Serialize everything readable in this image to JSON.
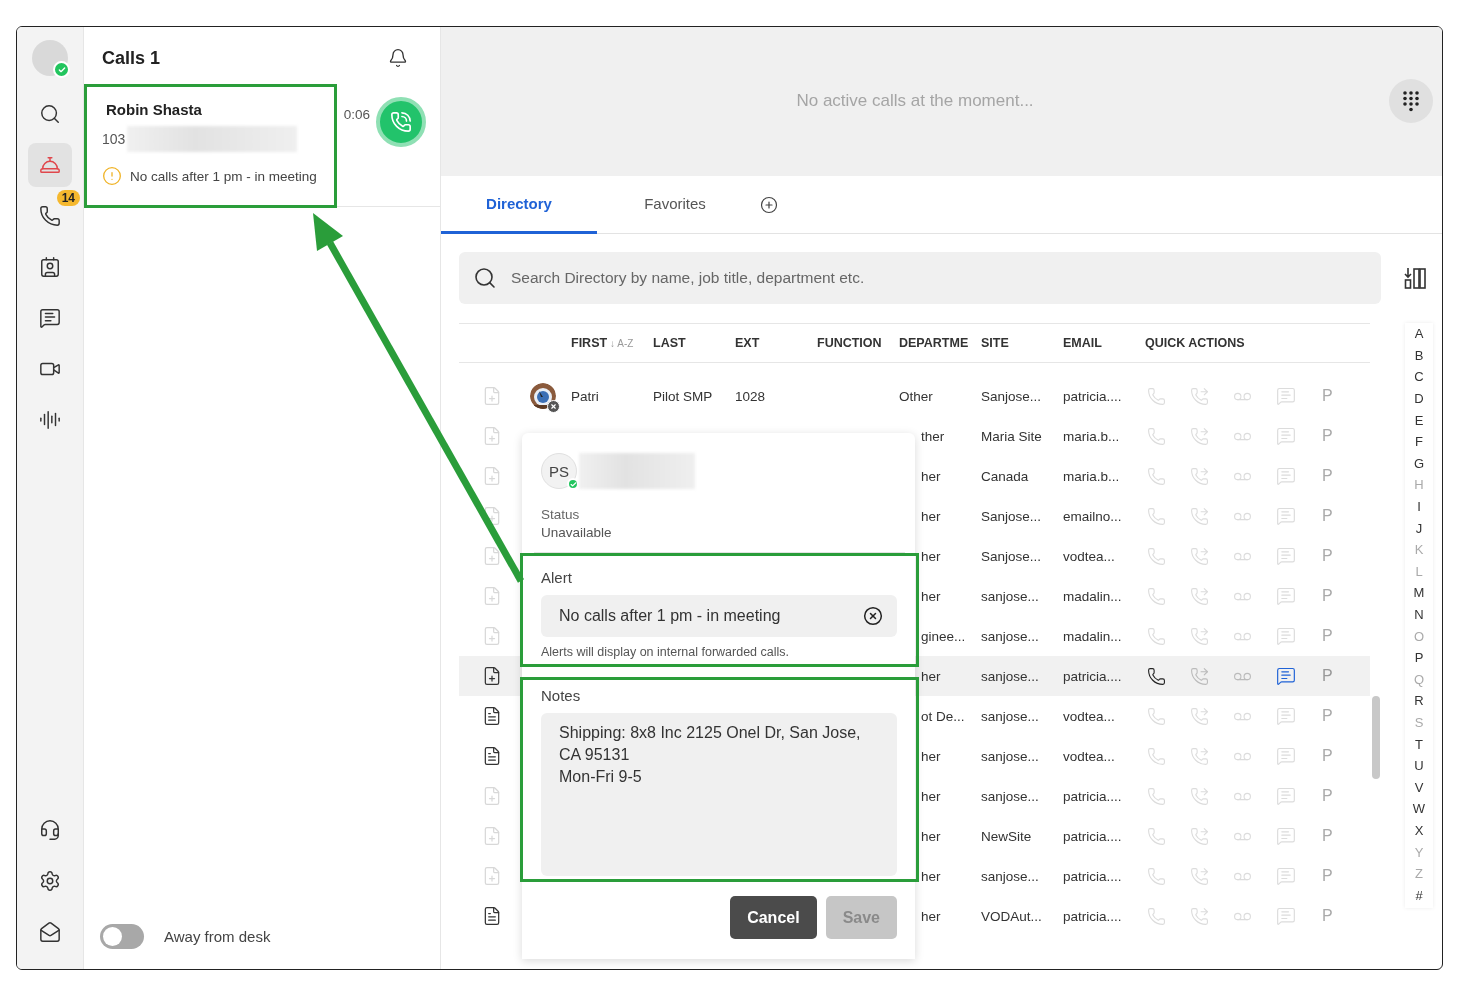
{
  "rail": {
    "user": {
      "online": true
    },
    "items": [
      {
        "kind": "search",
        "selected": false
      },
      {
        "kind": "reception",
        "selected": true
      },
      {
        "kind": "calls",
        "selected": false,
        "badge": "14"
      },
      {
        "kind": "contacts",
        "selected": false
      },
      {
        "kind": "chat",
        "selected": false
      },
      {
        "kind": "video",
        "selected": false
      },
      {
        "kind": "voice",
        "selected": false
      }
    ],
    "bottom_items": [
      {
        "kind": "support",
        "selected": false
      },
      {
        "kind": "settings",
        "selected": false
      },
      {
        "kind": "outbox",
        "selected": false
      }
    ]
  },
  "calls_panel": {
    "title": "Calls 1",
    "calls": [
      {
        "name": "Robin Shasta",
        "ext": "103",
        "alert": "No calls after 1 pm - in meeting",
        "timer": "0:06"
      }
    ],
    "away": {
      "label": "Away from desk",
      "on": false
    }
  },
  "main": {
    "empty_message": "No active calls at the moment...",
    "tabs": [
      {
        "label": "Directory",
        "selected": true
      },
      {
        "label": "Favorites",
        "selected": false
      }
    ],
    "search": {
      "placeholder": "Search Directory by name, job title, department etc."
    },
    "table": {
      "columns": [
        {
          "label": "FIRST",
          "sort": "↓ A-Z"
        },
        {
          "label": "LAST"
        },
        {
          "label": "EXT"
        },
        {
          "label": "FUNCTION"
        },
        {
          "label": "DEPARTME"
        },
        {
          "label": "SITE"
        },
        {
          "label": "EMAIL"
        },
        {
          "label": "QUICK ACTIONS"
        }
      ],
      "rows": [
        {
          "kind": "full",
          "selected": false,
          "has_note": false,
          "first": "Patri",
          "last": "Pilot SMP",
          "ext": "1028",
          "department": "Other",
          "site": "Sanjose...",
          "email": "patricia....",
          "presence": "P"
        },
        {
          "kind": "covered",
          "selected": false,
          "has_note": false,
          "department": "ther",
          "site": "Maria Site",
          "email": "maria.b...",
          "presence": "P"
        },
        {
          "kind": "covered",
          "selected": false,
          "has_note": false,
          "department": "her",
          "site": "Canada",
          "email": "maria.b...",
          "presence": "P"
        },
        {
          "kind": "covered",
          "selected": false,
          "has_note": false,
          "department": "her",
          "site": "Sanjose...",
          "email": "emailno...",
          "presence": "P"
        },
        {
          "kind": "covered",
          "selected": false,
          "has_note": false,
          "department": "her",
          "site": "Sanjose...",
          "email": "vodtea...",
          "presence": "P"
        },
        {
          "kind": "covered",
          "selected": false,
          "has_note": false,
          "department": "her",
          "site": "sanjose...",
          "email": "madalin...",
          "presence": "P"
        },
        {
          "kind": "covered",
          "selected": false,
          "has_note": false,
          "department": "ginee...",
          "site": "sanjose...",
          "email": "madalin...",
          "presence": "P"
        },
        {
          "kind": "covered",
          "selected": true,
          "has_note": false,
          "department": "her",
          "site": "sanjose...",
          "email": "patricia....",
          "presence": "P"
        },
        {
          "kind": "covered",
          "selected": false,
          "has_note": true,
          "department": "ot De...",
          "site": "sanjose...",
          "email": "vodtea...",
          "presence": "P"
        },
        {
          "kind": "covered",
          "selected": false,
          "has_note": true,
          "department": "her",
          "site": "sanjose...",
          "email": "vodtea...",
          "presence": "P"
        },
        {
          "kind": "covered",
          "selected": false,
          "has_note": false,
          "department": "her",
          "site": "sanjose...",
          "email": "patricia....",
          "presence": "P"
        },
        {
          "kind": "covered",
          "selected": false,
          "has_note": false,
          "department": "her",
          "site": "NewSite",
          "email": "patricia....",
          "presence": "P"
        },
        {
          "kind": "covered",
          "selected": false,
          "has_note": false,
          "department": "her",
          "site": "sanjose...",
          "email": "patricia....",
          "presence": "P"
        },
        {
          "kind": "covered",
          "selected": false,
          "has_note": true,
          "department": "her",
          "site": "VODAut...",
          "email": "patricia....",
          "presence": "P"
        }
      ]
    },
    "alphabet": [
      {
        "letter": "A",
        "disabled": false
      },
      {
        "letter": "B",
        "disabled": false
      },
      {
        "letter": "C",
        "disabled": false
      },
      {
        "letter": "D",
        "disabled": false
      },
      {
        "letter": "E",
        "disabled": false
      },
      {
        "letter": "F",
        "disabled": false
      },
      {
        "letter": "G",
        "disabled": false
      },
      {
        "letter": "H",
        "disabled": true
      },
      {
        "letter": "I",
        "disabled": false
      },
      {
        "letter": "J",
        "disabled": false
      },
      {
        "letter": "K",
        "disabled": true
      },
      {
        "letter": "L",
        "disabled": true
      },
      {
        "letter": "M",
        "disabled": false
      },
      {
        "letter": "N",
        "disabled": false
      },
      {
        "letter": "O",
        "disabled": true
      },
      {
        "letter": "P",
        "disabled": false
      },
      {
        "letter": "Q",
        "disabled": true
      },
      {
        "letter": "R",
        "disabled": false
      },
      {
        "letter": "S",
        "disabled": true
      },
      {
        "letter": "T",
        "disabled": false
      },
      {
        "letter": "U",
        "disabled": false
      },
      {
        "letter": "V",
        "disabled": false
      },
      {
        "letter": "W",
        "disabled": false
      },
      {
        "letter": "X",
        "disabled": false
      },
      {
        "letter": "Y",
        "disabled": true
      },
      {
        "letter": "Z",
        "disabled": true
      },
      {
        "letter": "#",
        "disabled": false
      }
    ],
    "contact_popup": {
      "initials": "PS",
      "online": true,
      "status_label": "Status",
      "status": "Unavailable",
      "alert_label": "Alert",
      "alert_value": "No calls after 1 pm - in meeting",
      "alert_hint": "Alerts will display on internal forwarded calls.",
      "notes_label": "Notes",
      "notes": "Shipping: 8x8 Inc 2125 Onel Dr, San Jose,\nCA 95131\nMon-Fri 9-5",
      "buttons": [
        {
          "label": "Cancel",
          "disabled": false
        },
        {
          "label": "Save",
          "disabled": true
        }
      ]
    }
  }
}
